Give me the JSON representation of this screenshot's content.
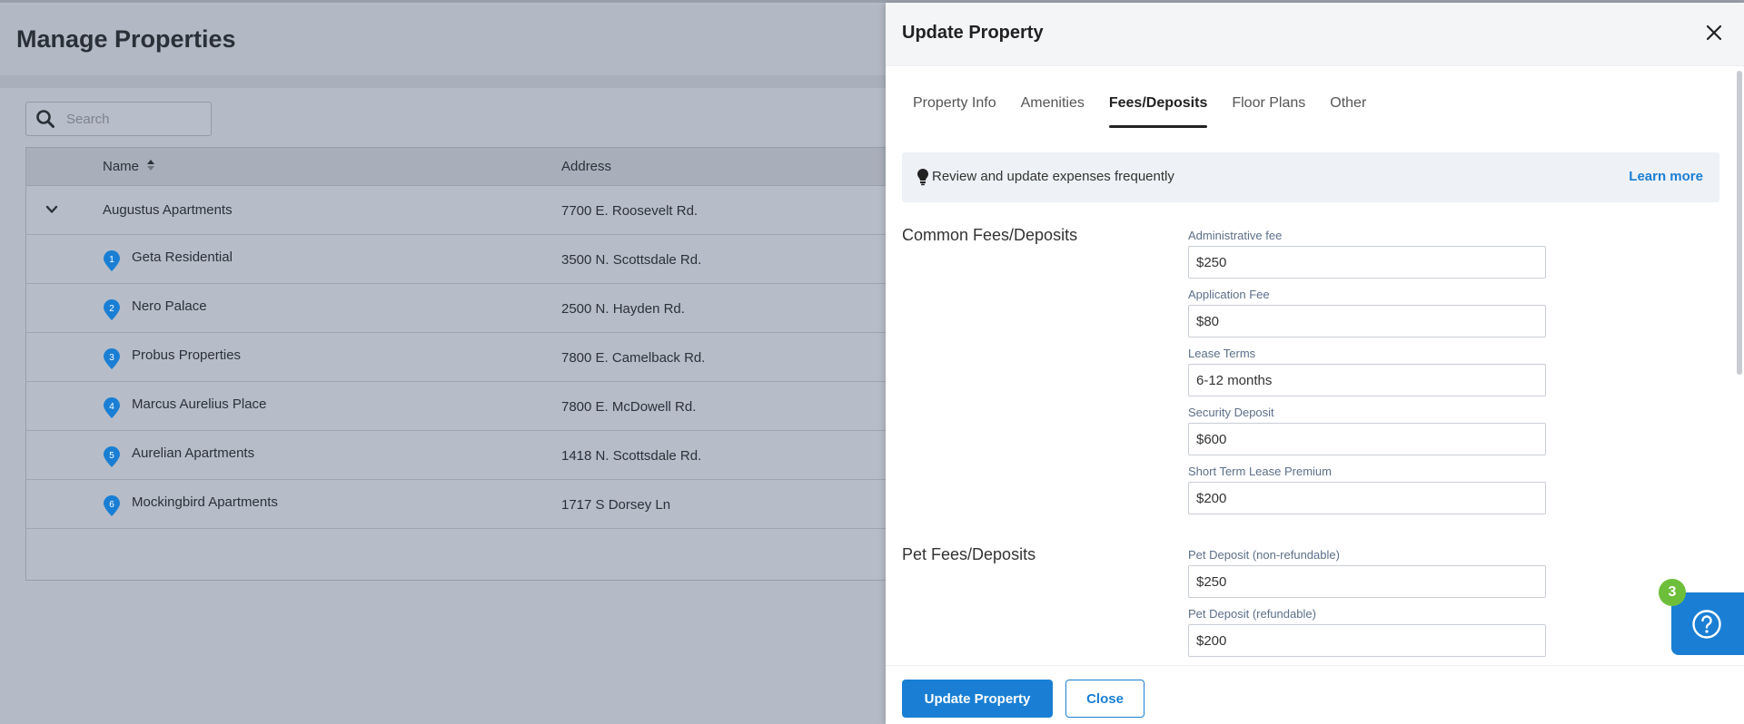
{
  "page": {
    "title": "Manage Properties",
    "search_placeholder": "Search"
  },
  "table": {
    "columns": {
      "name": "Name",
      "address": "Address"
    },
    "parent": {
      "name": "Augustus Apartments",
      "address": "7700 E. Roosevelt Rd."
    },
    "rows": [
      {
        "index": "1",
        "name": "Geta Residential",
        "address": "3500 N. Scottsdale Rd."
      },
      {
        "index": "2",
        "name": "Nero Palace",
        "address": "2500 N. Hayden Rd."
      },
      {
        "index": "3",
        "name": "Probus Properties",
        "address": "7800 E. Camelback Rd."
      },
      {
        "index": "4",
        "name": "Marcus Aurelius Place",
        "address": "7800 E. McDowell Rd."
      },
      {
        "index": "5",
        "name": "Aurelian Apartments",
        "address": "1418 N. Scottsdale Rd."
      },
      {
        "index": "6",
        "name": "Mockingbird Apartments",
        "address": "1717 S Dorsey Ln"
      }
    ]
  },
  "drawer": {
    "title": "Update Property",
    "tabs": [
      {
        "label": "Property Info"
      },
      {
        "label": "Amenities"
      },
      {
        "label": "Fees/Deposits",
        "active": true
      },
      {
        "label": "Floor Plans"
      },
      {
        "label": "Other"
      }
    ],
    "notice": {
      "text": "Review and update expenses frequently",
      "link": "Learn more"
    },
    "common": {
      "title": "Common Fees/Deposits",
      "fields": [
        {
          "label": "Administrative fee",
          "value": "$250"
        },
        {
          "label": "Application Fee",
          "value": "$80"
        },
        {
          "label": "Lease Terms",
          "value": "6-12 months"
        },
        {
          "label": "Security Deposit",
          "value": "$600"
        },
        {
          "label": "Short Term Lease Premium",
          "value": "$200"
        }
      ]
    },
    "pet": {
      "title": "Pet Fees/Deposits",
      "fields": [
        {
          "label": "Pet Deposit (non-refundable)",
          "value": "$250"
        },
        {
          "label": "Pet Deposit (refundable)",
          "value": "$200"
        }
      ]
    },
    "footer": {
      "update_label": "Update Property",
      "close_label": "Close"
    }
  },
  "help": {
    "badge_count": "3"
  },
  "colors": {
    "accent": "#1a7fd4",
    "badge": "#6dbf3b",
    "overlay": "#b5bbc6"
  }
}
